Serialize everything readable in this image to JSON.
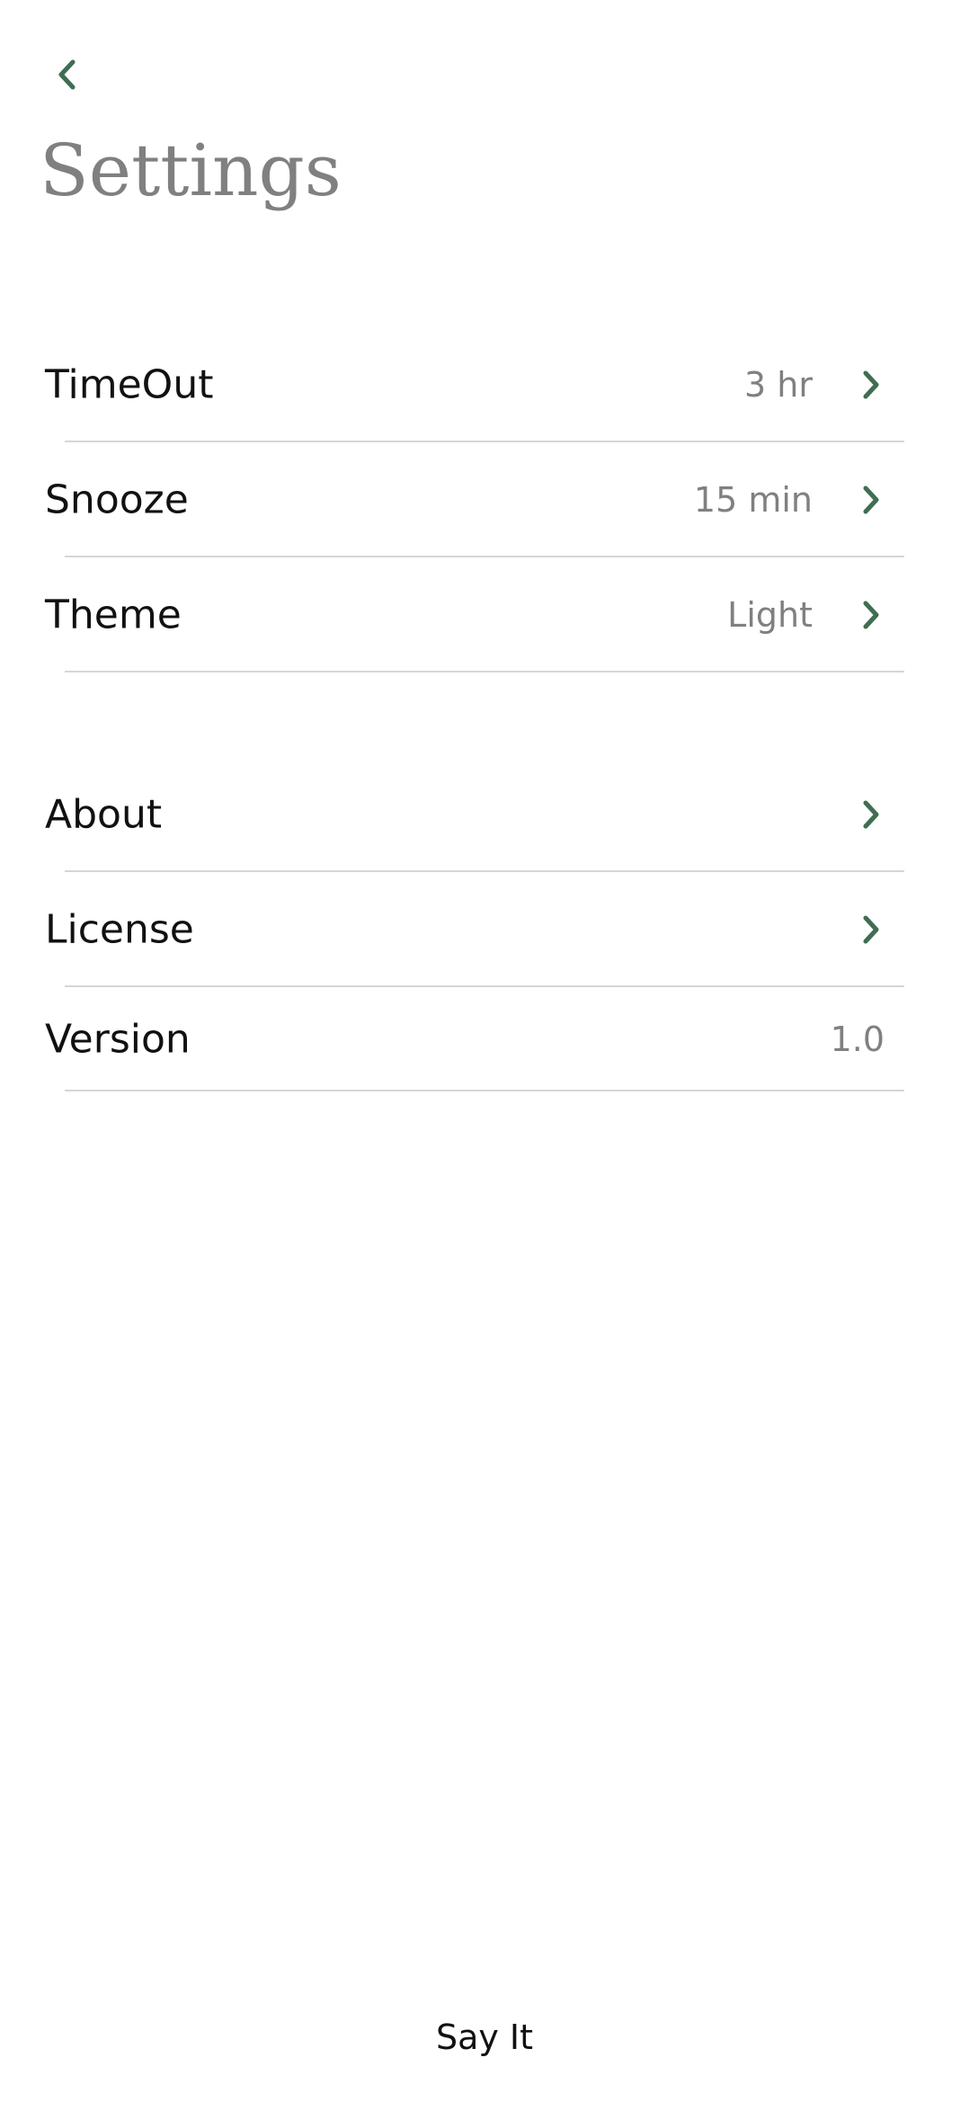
{
  "header": {
    "back_icon": "chevron-left-icon",
    "title": "Settings"
  },
  "accent_color": "#3f6e52",
  "sections": {
    "general": [
      {
        "label": "TimeOut",
        "value": "3 hr"
      },
      {
        "label": "Snooze",
        "value": "15 min"
      },
      {
        "label": "Theme",
        "value": "Light"
      }
    ],
    "info": [
      {
        "label": "About"
      },
      {
        "label": "License"
      },
      {
        "label": "Version",
        "value": "1.0"
      }
    ]
  },
  "footer": {
    "label": "Say It"
  }
}
